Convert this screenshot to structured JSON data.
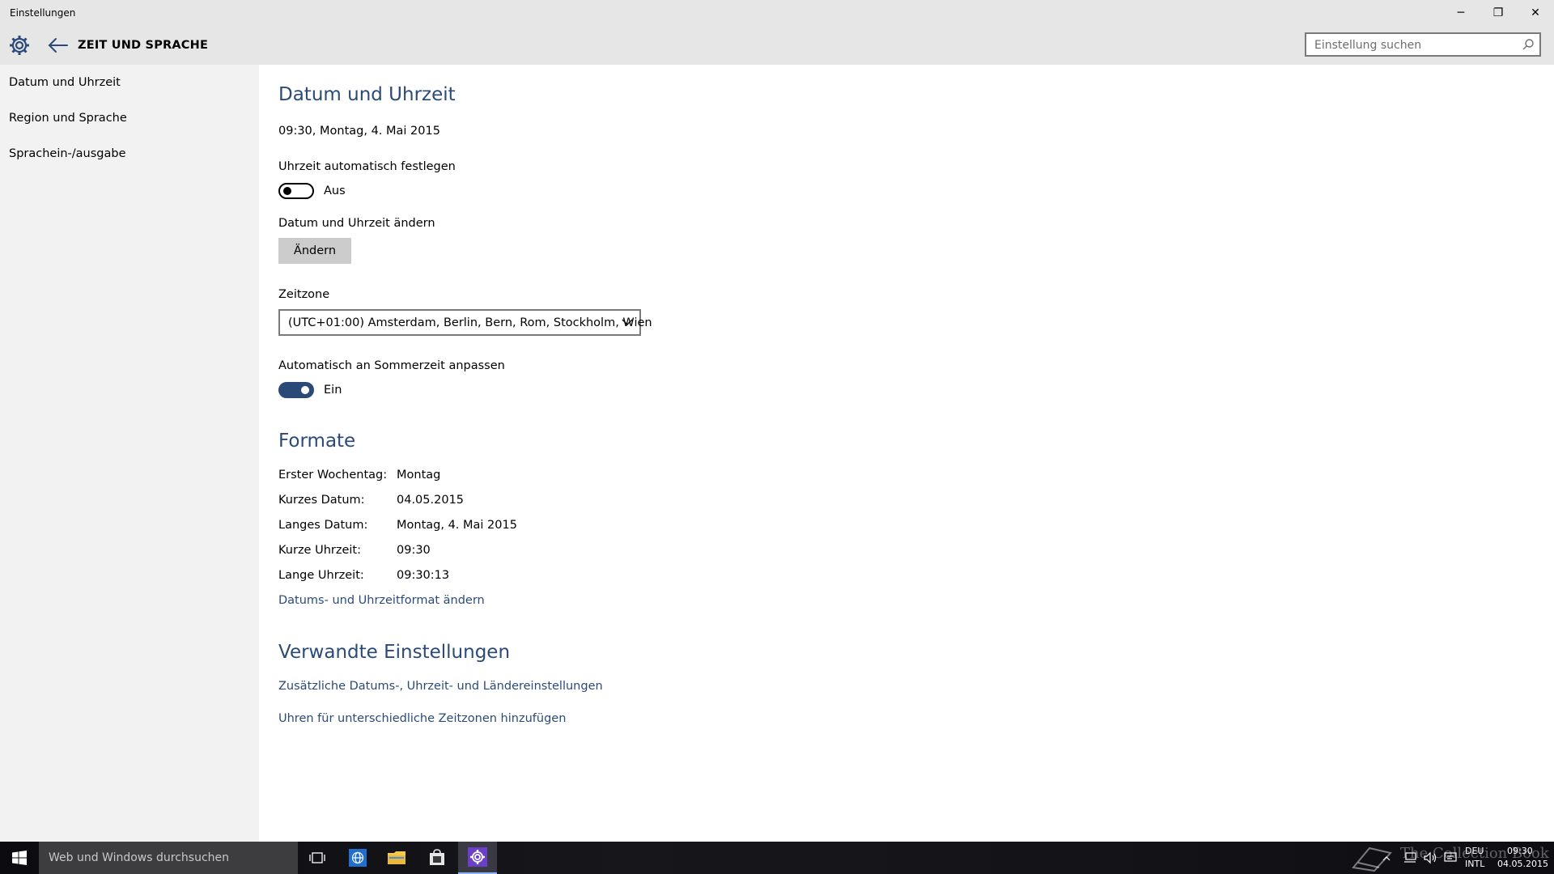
{
  "window": {
    "title": "Einstellungen",
    "minimize_glyph": "─",
    "maximize_glyph": "❐",
    "close_glyph": "✕"
  },
  "header": {
    "section_title": "ZEIT UND SPRACHE",
    "search_placeholder": "Einstellung suchen"
  },
  "sidebar": {
    "items": [
      {
        "label": "Datum und Uhrzeit"
      },
      {
        "label": "Region und Sprache"
      },
      {
        "label": "Sprachein-/ausgabe"
      }
    ]
  },
  "datetime": {
    "heading": "Datum und Uhrzeit",
    "current": "09:30, Montag, 4. Mai 2015",
    "auto_time_label": "Uhrzeit automatisch festlegen",
    "auto_time_state": "Aus",
    "auto_time_on": false,
    "change_label": "Datum und Uhrzeit ändern",
    "change_button": "Ändern",
    "timezone_label": "Zeitzone",
    "timezone_value": "(UTC+01:00) Amsterdam, Berlin, Bern, Rom, Stockholm, Wien",
    "dst_label": "Automatisch an Sommerzeit anpassen",
    "dst_state": "Ein",
    "dst_on": true
  },
  "formats": {
    "heading": "Formate",
    "rows": [
      {
        "label": "Erster Wochentag:",
        "value": "Montag"
      },
      {
        "label": "Kurzes Datum:",
        "value": "04.05.2015"
      },
      {
        "label": "Langes Datum:",
        "value": "Montag, 4. Mai 2015"
      },
      {
        "label": "Kurze Uhrzeit:",
        "value": "09:30"
      },
      {
        "label": "Lange Uhrzeit:",
        "value": "09:30:13"
      }
    ],
    "change_link": "Datums- und Uhrzeitformat ändern"
  },
  "related": {
    "heading": "Verwandte Einstellungen",
    "links": [
      "Zusätzliche Datums-, Uhrzeit- und Ländereinstellungen",
      "Uhren für unterschiedliche Zeitzonen hinzufügen"
    ]
  },
  "taskbar": {
    "search_placeholder": "Web und Windows durchsuchen",
    "language": "DEU",
    "keyboard": "INTL",
    "time": "09:30",
    "date": "04.05.2015",
    "watermark": "The Collection Book"
  },
  "colors": {
    "accent": "#2b4a78",
    "header_bg": "#e6e6e6",
    "nav_bg": "#f2f2f2",
    "button_bg": "#cccccc"
  }
}
